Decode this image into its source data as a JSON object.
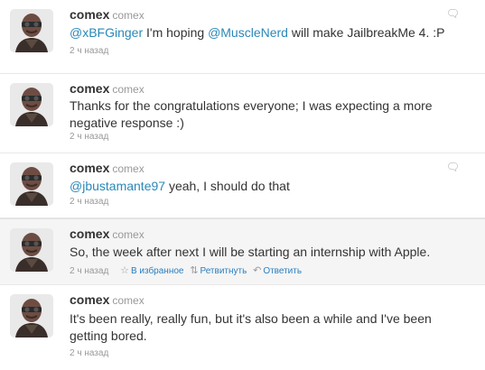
{
  "tweets": [
    {
      "name": "comex",
      "handle": "comex",
      "text_parts": [
        {
          "t": "@xBFGinger",
          "mention": true
        },
        {
          "t": " I'm hoping "
        },
        {
          "t": "@MuscleNerd",
          "mention": true
        },
        {
          "t": " will make JailbreakMe 4. :P"
        }
      ],
      "time": "2 ч назад",
      "reply_icon": true
    },
    {
      "name": "comex",
      "handle": "comex",
      "text_parts": [
        {
          "t": "Thanks for the congratulations everyone; I was expecting a more negative response :)"
        }
      ],
      "time": "2 ч назад",
      "reply_icon": false
    },
    {
      "name": "comex",
      "handle": "comex",
      "text_parts": [
        {
          "t": "@jbustamante97",
          "mention": true
        },
        {
          "t": " yeah, I should do that"
        }
      ],
      "time": "2 ч назад",
      "reply_icon": true
    },
    {
      "name": "comex",
      "handle": "comex",
      "text_parts": [
        {
          "t": "So, the week after next I will be starting an internship with Apple."
        }
      ],
      "time": "2 ч назад",
      "reply_icon": false,
      "actions": {
        "favorite": "В избранное",
        "retweet": "Ретвитнуть",
        "reply": "Ответить"
      }
    },
    {
      "name": "comex",
      "handle": "comex",
      "text_parts": [
        {
          "t": "It's been really, really fun, but it's also been a while and I've been getting bored."
        }
      ],
      "time": "2 ч назад",
      "reply_icon": false
    }
  ],
  "colors": {
    "mention": "#2a88b8",
    "action_link": "#2a7fbf",
    "hover_bg": "#f5f5f5"
  },
  "icons": {
    "reply": "speech-bubble-icon",
    "favorite": "star-icon",
    "retweet": "retweet-icon",
    "reply_action": "reply-arrow-icon"
  }
}
